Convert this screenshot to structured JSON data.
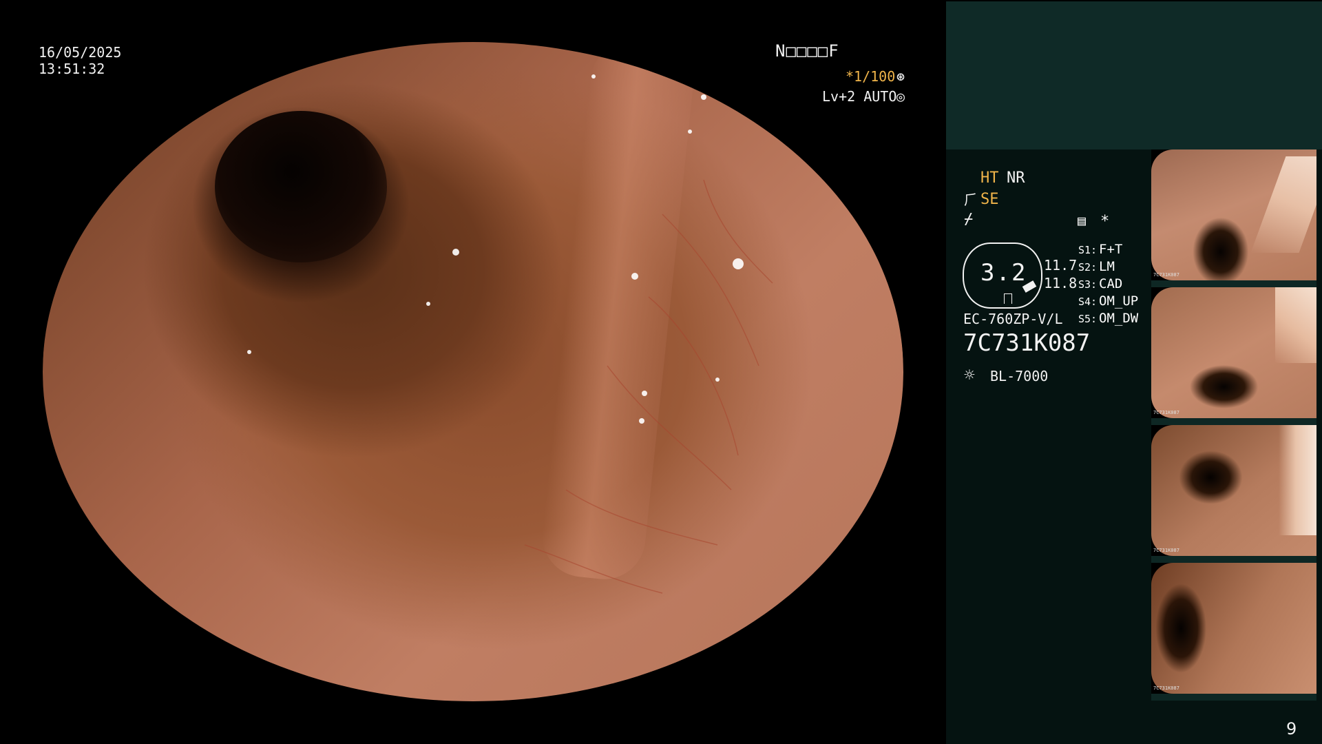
{
  "overlay": {
    "date": "16/05/2025",
    "time": "13:51:32",
    "patient_id": "N□□□□F",
    "shutter": "*1/100",
    "shutter_icon": "iris-icon",
    "level": "Lv+2 AUTO",
    "auto_icon": "target-icon"
  },
  "panel": {
    "ht": "HT",
    "nr": "NR",
    "se": "SE",
    "se_icon": "⺁",
    "no_flash_icon": "⌿",
    "menu_icon": "▤",
    "star": "*",
    "lens_value": "3.2",
    "value_1": "11.7",
    "value_2": "11.8",
    "settings": [
      {
        "label": "S1:",
        "value": "F+T"
      },
      {
        "label": "S2:",
        "value": "LM"
      },
      {
        "label": "S3:",
        "value": "CAD"
      },
      {
        "label": "S4:",
        "value": "OM_UP"
      },
      {
        "label": "S5:",
        "value": "OM_DW"
      }
    ],
    "scope_model": "EC-760ZP-V/L",
    "scope_serial": "7C731K087",
    "light_icon": "☼",
    "light_source": "BL-7000"
  },
  "thumbnails": [
    {
      "label": "7C731K087"
    },
    {
      "label": "7C731K087"
    },
    {
      "label": "7C731K087"
    },
    {
      "label": "7C731K087"
    }
  ],
  "page_number": "9",
  "colors": {
    "accent_orange": "#f0b44a",
    "panel_dark": "#051311",
    "panel_top": "#0f2a27"
  }
}
